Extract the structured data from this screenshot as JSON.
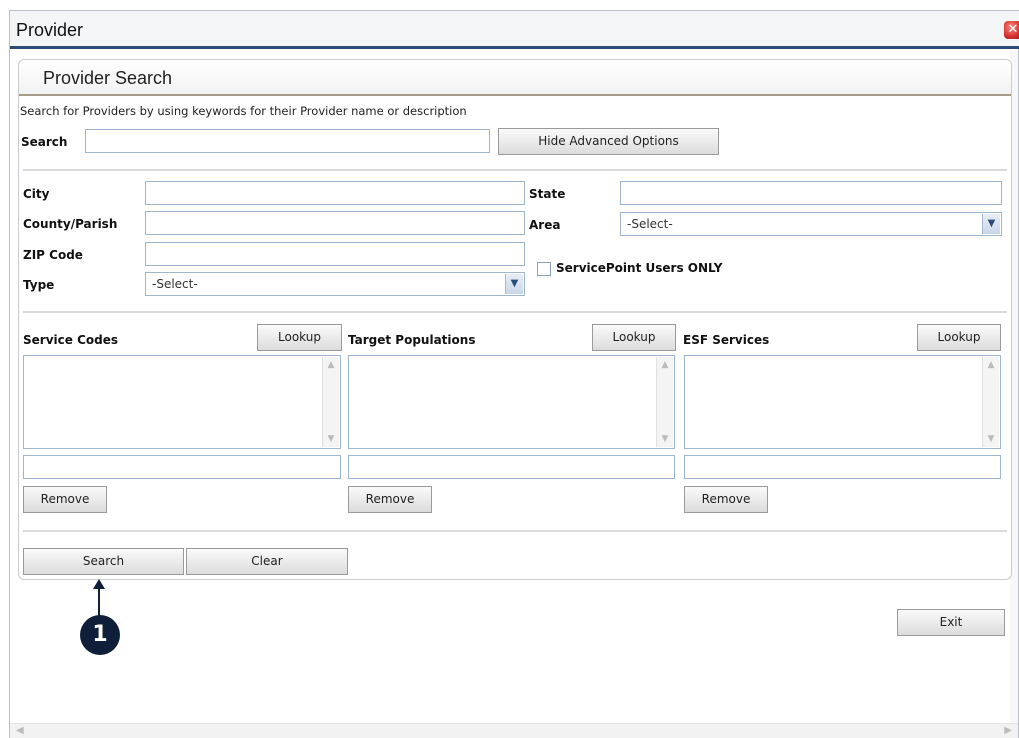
{
  "window": {
    "title": "Provider",
    "close_icon": "close-icon"
  },
  "panel": {
    "title": "Provider Search",
    "hint": "Search for Providers by using keywords for their Provider name or description",
    "search_label": "Search",
    "search_value": "",
    "advanced_button": "Hide Advanced Options"
  },
  "fields": {
    "city_label": "City",
    "county_label": "County/Parish",
    "zip_label": "ZIP Code",
    "type_label": "Type",
    "type_value": "-Select-",
    "state_label": "State",
    "area_label": "Area",
    "area_value": "-Select-",
    "servicepoint_label": "ServicePoint Users ONLY"
  },
  "lookups": [
    {
      "label": "Service Codes",
      "lookup": "Lookup",
      "remove": "Remove"
    },
    {
      "label": "Target Populations",
      "lookup": "Lookup",
      "remove": "Remove"
    },
    {
      "label": "ESF Services",
      "lookup": "Lookup",
      "remove": "Remove"
    }
  ],
  "actions": {
    "search": "Search",
    "clear": "Clear",
    "exit": "Exit"
  },
  "callout": {
    "number": "1"
  }
}
